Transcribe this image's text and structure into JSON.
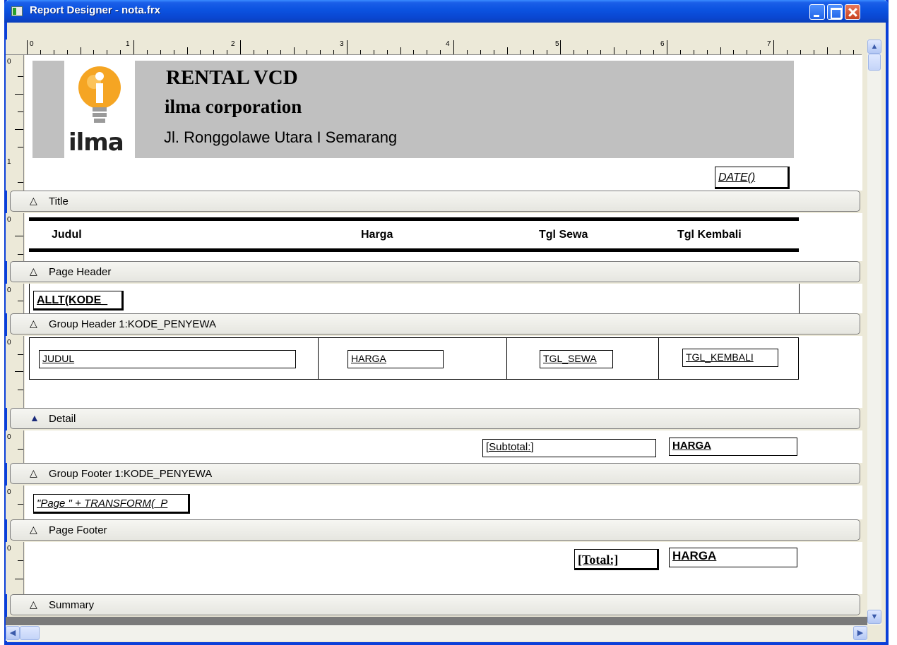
{
  "window": {
    "title": "Report Designer - nota.frx"
  },
  "ruler": {
    "marks": [
      "0",
      "1",
      "2",
      "3",
      "4",
      "5",
      "6",
      "7"
    ]
  },
  "title_band": {
    "logo_text": "ilma",
    "heading": "RENTAL VCD",
    "company": "ilma corporation",
    "address": "Jl. Ronggolawe Utara I Semarang",
    "date_field": "DATE()",
    "label": "Title"
  },
  "page_header": {
    "col_judul": "Judul",
    "col_harga": "Harga",
    "col_tgl_sewa": "Tgl Sewa",
    "col_tgl_kembali": "Tgl Kembali",
    "label": "Page Header"
  },
  "group_header": {
    "field": "ALLT(KODE_",
    "label": "Group Header 1:KODE_PENYEWA"
  },
  "detail": {
    "judul": "JUDUL",
    "harga": "HARGA",
    "tgl_sewa": "TGL_SEWA",
    "tgl_kembali": "TGL_KEMBALI",
    "label": "Detail"
  },
  "group_footer": {
    "subtotal_label": "[Subtotal:]",
    "harga": "HARGA",
    "label": "Group Footer 1:KODE_PENYEWA"
  },
  "page_footer": {
    "page_expr": "\"Page \" + TRANSFORM(_P",
    "label": "Page Footer"
  },
  "summary": {
    "total_label": "[Total:]",
    "harga": "HARGA",
    "label": "Summary"
  }
}
